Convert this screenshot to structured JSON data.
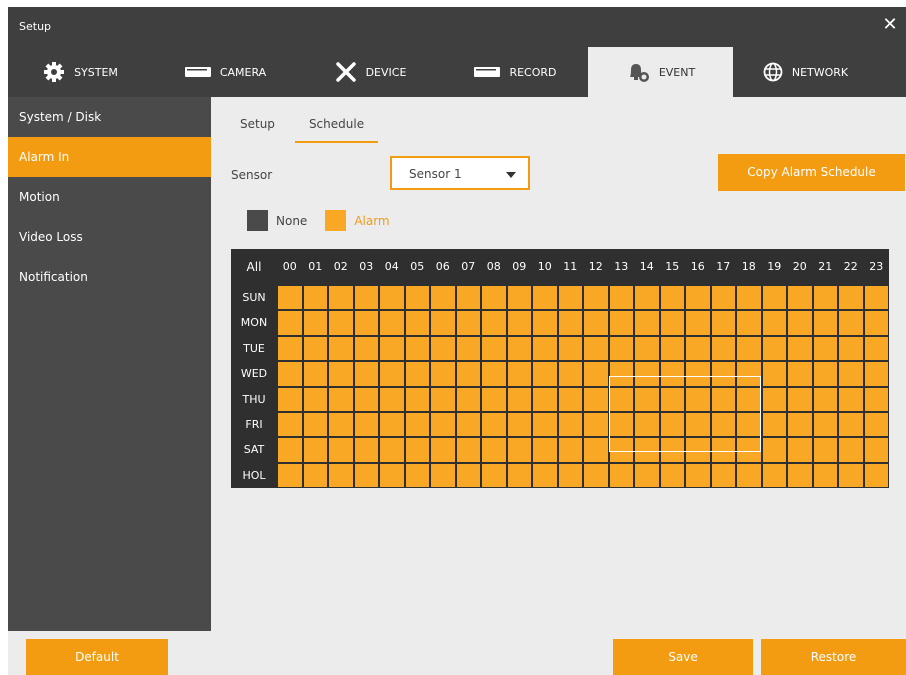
{
  "window": {
    "title": "Setup",
    "close_icon": "close-icon"
  },
  "topnav": {
    "tabs": [
      {
        "label": "SYSTEM",
        "icon": "gear-icon",
        "active": false
      },
      {
        "label": "CAMERA",
        "icon": "camera-icon",
        "active": false
      },
      {
        "label": "DEVICE",
        "icon": "tools-icon",
        "active": false
      },
      {
        "label": "RECORD",
        "icon": "record-icon",
        "active": false
      },
      {
        "label": "EVENT",
        "icon": "bell-icon",
        "active": true
      },
      {
        "label": "NETWORK",
        "icon": "globe-icon",
        "active": false
      }
    ]
  },
  "sidebar": {
    "items": [
      {
        "label": "System / Disk",
        "active": false
      },
      {
        "label": "Alarm In",
        "active": true
      },
      {
        "label": "Motion",
        "active": false
      },
      {
        "label": "Video Loss",
        "active": false
      },
      {
        "label": "Notification",
        "active": false
      }
    ]
  },
  "subtabs": [
    {
      "label": "Setup",
      "active": false
    },
    {
      "label": "Schedule",
      "active": true
    }
  ],
  "sensor": {
    "label": "Sensor",
    "value": "Sensor 1"
  },
  "copy_button": "Copy Alarm Schedule",
  "legend": {
    "none": "None",
    "alarm": "Alarm"
  },
  "schedule": {
    "all_label": "All",
    "hours": [
      "00",
      "01",
      "02",
      "03",
      "04",
      "05",
      "06",
      "07",
      "08",
      "09",
      "10",
      "11",
      "12",
      "13",
      "14",
      "15",
      "16",
      "17",
      "18",
      "19",
      "20",
      "21",
      "22",
      "23"
    ],
    "days": [
      "SUN",
      "MON",
      "TUE",
      "WED",
      "THU",
      "FRI",
      "SAT",
      "HOL"
    ],
    "cell_state": "Alarm"
  },
  "buttons": {
    "default": "Default",
    "save": "Save",
    "restore": "Restore"
  },
  "colors": {
    "accent": "#f39c12",
    "alarm": "#f9a825",
    "none": "#4a4a4a",
    "dark": "#3f3f3f"
  }
}
